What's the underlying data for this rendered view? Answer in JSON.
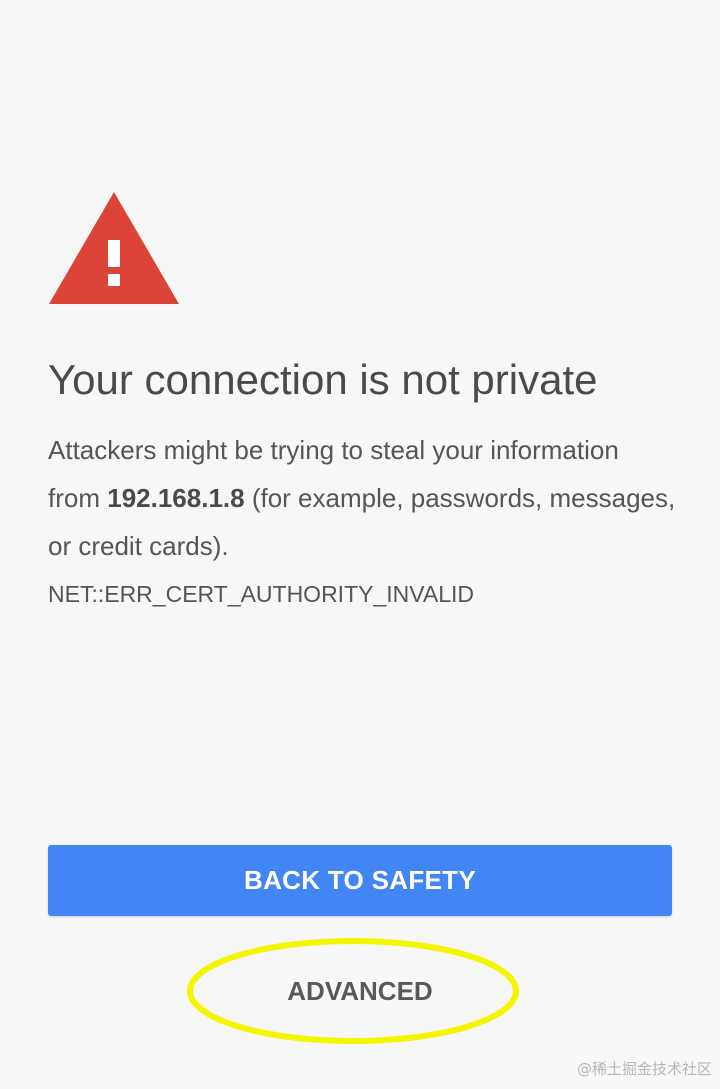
{
  "interstitial": {
    "icon": "warning-triangle-icon",
    "icon_color": "#db4437",
    "title": "Your connection is not private",
    "body_part1": "Attackers might be trying to steal your information from ",
    "host": "192.168.1.8",
    "body_part2": " (for example, passwords, messages, or credit cards).",
    "error_code": "NET::ERR_CERT_AUTHORITY_INVALID"
  },
  "actions": {
    "back_to_safety_label": "BACK TO SAFETY",
    "advanced_label": "ADVANCED",
    "primary_color": "#4285f4"
  },
  "annotation": {
    "highlight_color": "#f5f500",
    "highlight_target": "ADVANCED"
  },
  "watermark": {
    "text": "@稀土掘金技术社区"
  }
}
